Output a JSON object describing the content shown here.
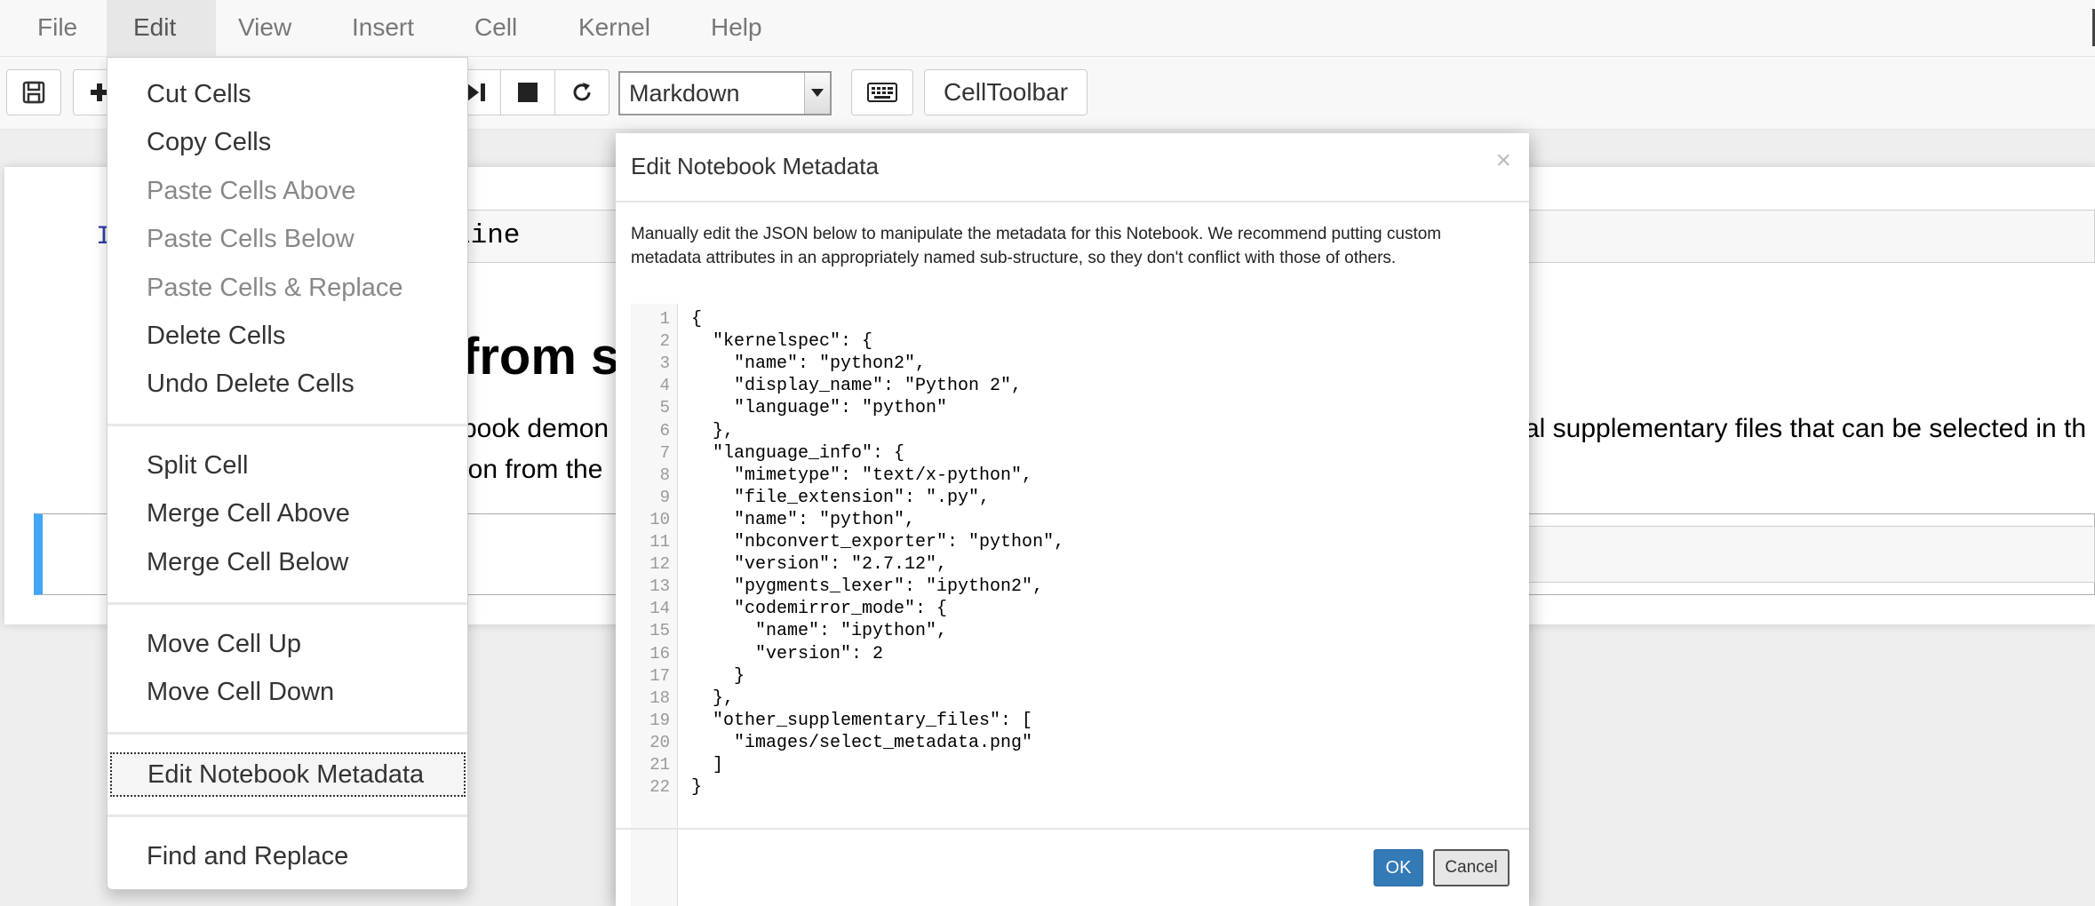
{
  "menubar": {
    "items": [
      {
        "label": "File"
      },
      {
        "label": "Edit"
      },
      {
        "label": "View"
      },
      {
        "label": "Insert"
      },
      {
        "label": "Cell"
      },
      {
        "label": "Kernel"
      },
      {
        "label": "Help"
      }
    ]
  },
  "toolbar": {
    "cell_type": "Markdown",
    "celltoolbar_label": "CellToolbar",
    "icons": [
      "save-icon",
      "plus-icon",
      "fast-forward-icon",
      "stop-icon",
      "refresh-icon",
      "keyboard-icon"
    ]
  },
  "notebook": {
    "code_prompt": "I",
    "code_text": "line",
    "heading_fragment": "from s",
    "text_line1": "book demon",
    "text_line2": "ion from the",
    "text_right": "al supplementary files that can be selected in th"
  },
  "edit_menu": {
    "items": [
      {
        "label": "Cut Cells",
        "enabled": true
      },
      {
        "label": "Copy Cells",
        "enabled": true
      },
      {
        "label": "Paste Cells Above",
        "enabled": false
      },
      {
        "label": "Paste Cells Below",
        "enabled": false
      },
      {
        "label": "Paste Cells & Replace",
        "enabled": false
      },
      {
        "label": "Delete Cells",
        "enabled": true
      },
      {
        "label": "Undo Delete Cells",
        "enabled": true
      },
      {
        "label": "Split Cell",
        "enabled": true
      },
      {
        "label": "Merge Cell Above",
        "enabled": true
      },
      {
        "label": "Merge Cell Below",
        "enabled": true
      },
      {
        "label": "Move Cell Up",
        "enabled": true
      },
      {
        "label": "Move Cell Down",
        "enabled": true
      },
      {
        "label": "Edit Notebook Metadata",
        "enabled": true,
        "focused": true
      },
      {
        "label": "Find and Replace",
        "enabled": true
      }
    ]
  },
  "modal": {
    "title": "Edit Notebook Metadata",
    "close_symbol": "×",
    "description": "Manually edit the JSON below to manipulate the metadata for this Notebook. We recommend putting custom metadata attributes in an appropriately named sub-structure, so they don't conflict with those of others.",
    "json_lines": [
      "{",
      "  \"kernelspec\": {",
      "    \"name\": \"python2\",",
      "    \"display_name\": \"Python 2\",",
      "    \"language\": \"python\"",
      "  },",
      "  \"language_info\": {",
      "    \"mimetype\": \"text/x-python\",",
      "    \"file_extension\": \".py\",",
      "    \"name\": \"python\",",
      "    \"nbconvert_exporter\": \"python\",",
      "    \"version\": \"2.7.12\",",
      "    \"pygments_lexer\": \"ipython2\",",
      "    \"codemirror_mode\": {",
      "      \"name\": \"ipython\",",
      "      \"version\": 2",
      "    }",
      "  },",
      "  \"other_supplementary_files\": [",
      "    \"images/select_metadata.png\"",
      "  ]",
      "}"
    ],
    "ok_label": "OK",
    "cancel_label": "Cancel"
  },
  "colors": {
    "accent": "#337ab7",
    "selected_cell": "#42a5f5"
  }
}
